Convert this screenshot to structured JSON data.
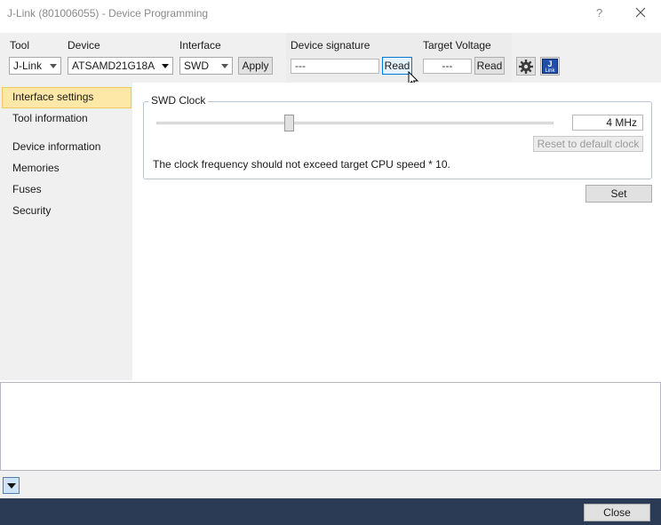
{
  "window": {
    "title": "J-Link (801006055) - Device Programming",
    "help_glyph": "?",
    "close_glyph": "close-icon"
  },
  "toolbar": {
    "tool_label": "Tool",
    "tool_value": "J-Link",
    "device_label": "Device",
    "device_value": "ATSAMD21G18A",
    "interface_label": "Interface",
    "interface_value": "SWD",
    "apply_label": "Apply",
    "signature_label": "Device signature",
    "signature_value": "---",
    "signature_read_label": "Read",
    "voltage_label": "Target Voltage",
    "voltage_value": "---",
    "voltage_read_label": "Read",
    "settings_icon": "gear-icon",
    "jlink_icon": "jlink-logo-icon",
    "jlink_icon_text_top": "J",
    "jlink_icon_text_bottom": "Link"
  },
  "sidebar": {
    "items": [
      {
        "label": "Interface settings",
        "active": true
      },
      {
        "label": "Tool information",
        "active": false
      },
      {
        "label": "Device information",
        "active": false
      },
      {
        "label": "Memories",
        "active": false
      },
      {
        "label": "Fuses",
        "active": false
      },
      {
        "label": "Security",
        "active": false
      }
    ]
  },
  "swd_clock": {
    "group_title": "SWD Clock",
    "value_display": "4 MHz",
    "slider_level": 0.33,
    "reset_label": "Reset to default clock",
    "note": "The clock frequency should not exceed target CPU speed * 10.",
    "set_label": "Set"
  },
  "footer": {
    "expander_icon": "chevron-down-icon",
    "close_label": "Close"
  },
  "colors": {
    "accent": "#0078d7",
    "active_nav": "#fde8a8",
    "footer_bg": "#2b3a55"
  }
}
